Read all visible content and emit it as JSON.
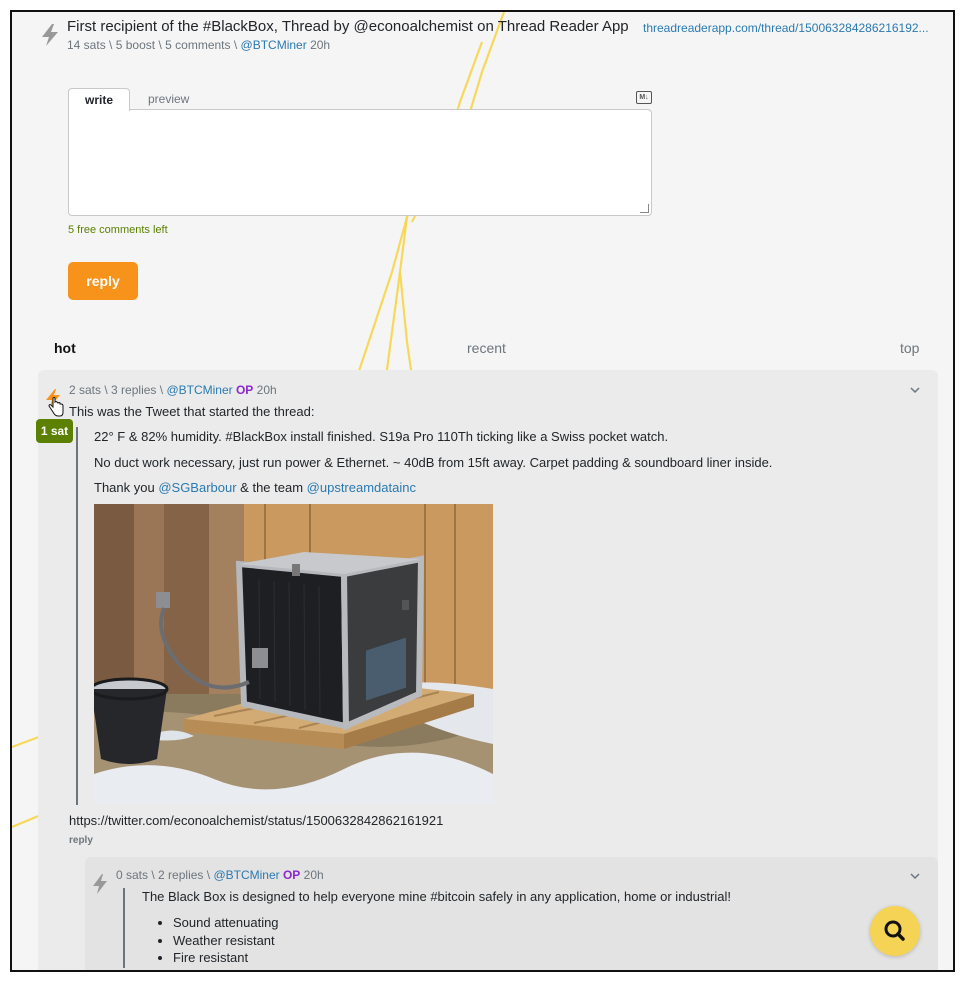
{
  "post": {
    "title": "First recipient of the #BlackBox, Thread by @econoalchemist on Thread Reader App",
    "url": "threadreaderapp.com/thread/150063284286216192...",
    "sats": "14 sats",
    "boost": "5 boost",
    "comments": "5 comments",
    "author": "@BTCMiner",
    "age": "20h",
    "sep": "\\"
  },
  "editor": {
    "tab_write": "write",
    "tab_preview": "preview",
    "markdown_badge": "M↓",
    "free_comments": "5 free comments left",
    "reply_label": "reply"
  },
  "sort": {
    "hot": "hot",
    "recent": "recent",
    "top": "top"
  },
  "comment1": {
    "sats": "2 sats",
    "replies": "3 replies",
    "author": "@BTCMiner",
    "op": "OP",
    "age": "20h",
    "badge": "1 sat",
    "intro": "This was the Tweet that started the thread:",
    "quote_line1": "22° F & 82% humidity. #BlackBox install finished. S19a Pro 110Th ticking like a Swiss pocket watch.",
    "quote_line2": "No duct work necessary, just run power & Ethernet. ~ 40dB from 15ft away. Carpet padding & soundboard liner inside.",
    "quote_line3_a": "Thank you ",
    "mention1": "@SGBarbour",
    "quote_line3_b": " & the team ",
    "mention2": "@upstreamdatainc",
    "link": "https://twitter.com/econoalchemist/status/1500632842862161921",
    "reply_label": "reply"
  },
  "comment2": {
    "sats": "0 sats",
    "replies": "2 replies",
    "author": "@BTCMiner",
    "op": "OP",
    "age": "20h",
    "text": "The Black Box is designed to help everyone mine #bitcoin safely in any application, home or industrial!",
    "bullets": [
      "Sound attenuating",
      "Weather resistant",
      "Fire resistant"
    ]
  },
  "colors": {
    "accent": "#f7931a",
    "link": "#2a7ab0",
    "op": "#8b28c9",
    "sat_badge": "#5c8001",
    "lightning": "#f7d54a",
    "fab": "#f5d354"
  },
  "icons": [
    "bolt-icon",
    "markdown-icon",
    "chevron-down-icon",
    "hand-cursor-icon",
    "search-icon"
  ]
}
